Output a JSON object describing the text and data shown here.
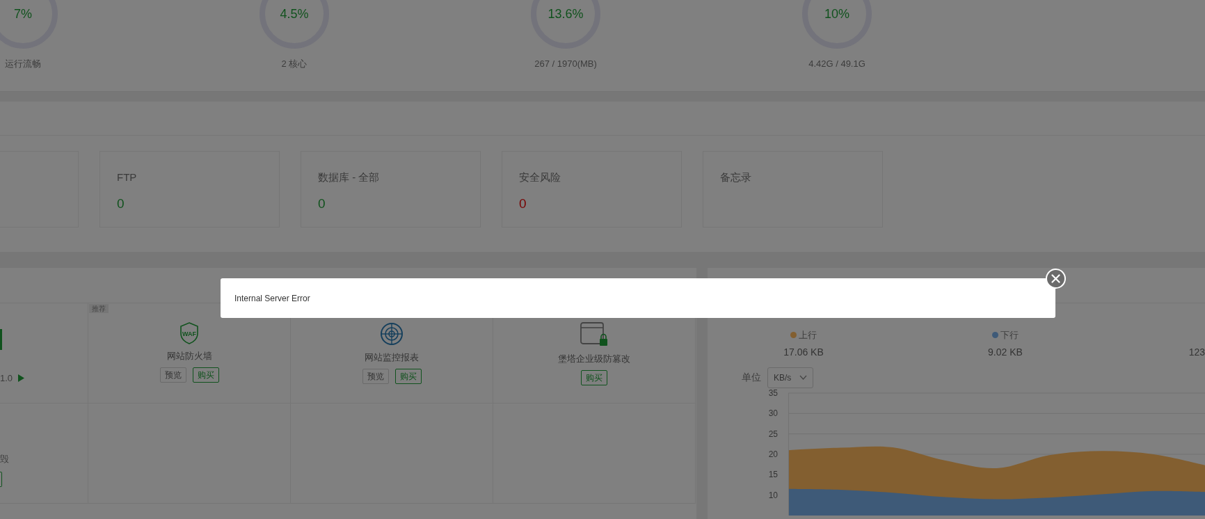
{
  "gauges": [
    {
      "value": "7%",
      "label": "运行流畅"
    },
    {
      "value": "4.5%",
      "label": "2 核心"
    },
    {
      "value": "13.6%",
      "label": "267 / 1970(MB)"
    },
    {
      "value": "10%",
      "label": "4.42G / 49.1G"
    }
  ],
  "overview_cards": [
    {
      "title": "FTP",
      "value": "0",
      "color": "#10521d"
    },
    {
      "title": "数据库 - 全部",
      "value": "0",
      "color": "#10521d"
    },
    {
      "title": "安全风险",
      "value": "0",
      "color": "#770404"
    },
    {
      "title": "备忘录"
    }
  ],
  "software_grid": {
    "rows": [
      {
        "cells": [
          {
            "kind": "text-play",
            "text": "1.0"
          },
          {
            "kind": "app",
            "tag": "推荐",
            "icon_text": "WAF",
            "name": "网站防火墙",
            "buttons": [
              {
                "label": "预览",
                "kind": "preview"
              },
              {
                "label": "购买",
                "kind": "buy"
              }
            ]
          },
          {
            "kind": "app",
            "name": "网站监控报表",
            "buttons": [
              {
                "label": "预览",
                "kind": "preview"
              },
              {
                "label": "购买",
                "kind": "buy"
              }
            ]
          },
          {
            "kind": "app",
            "name": "堡塔企业级防篡改",
            "buttons": [
              {
                "label": "购买",
                "kind": "buy"
              }
            ]
          }
        ]
      },
      {
        "cells": [
          {
            "kind": "text-button",
            "text": "毁"
          },
          {
            "kind": "empty"
          },
          {
            "kind": "empty"
          },
          {
            "kind": "empty"
          }
        ]
      }
    ]
  },
  "traffic": {
    "legend": [
      {
        "total": "17.06 KB"
      },
      {
        "total": "9.02 KB"
      },
      {
        "total": "123"
      }
    ],
    "unit_label": "单位",
    "unit": "KB/s",
    "chart_data": {
      "type": "area",
      "stacked": false,
      "grid": true,
      "ylim": [
        5,
        35
      ],
      "yticks": [
        10,
        15,
        20,
        25,
        30,
        35
      ],
      "series": [
        {
          "name": "上行",
          "color": "#835f30",
          "values": [
            21.0,
            21.6,
            21.7,
            18.5,
            16.6,
            19.8,
            20.8,
            20.0,
            17.3
          ]
        },
        {
          "name": "下行",
          "color": "#3e5a78",
          "values": [
            11.5,
            11.3,
            10.6,
            9.5,
            9.0,
            9.4,
            10.2,
            11.0,
            10.8
          ]
        }
      ]
    }
  },
  "modal": {
    "message": "Internal Server Error"
  }
}
